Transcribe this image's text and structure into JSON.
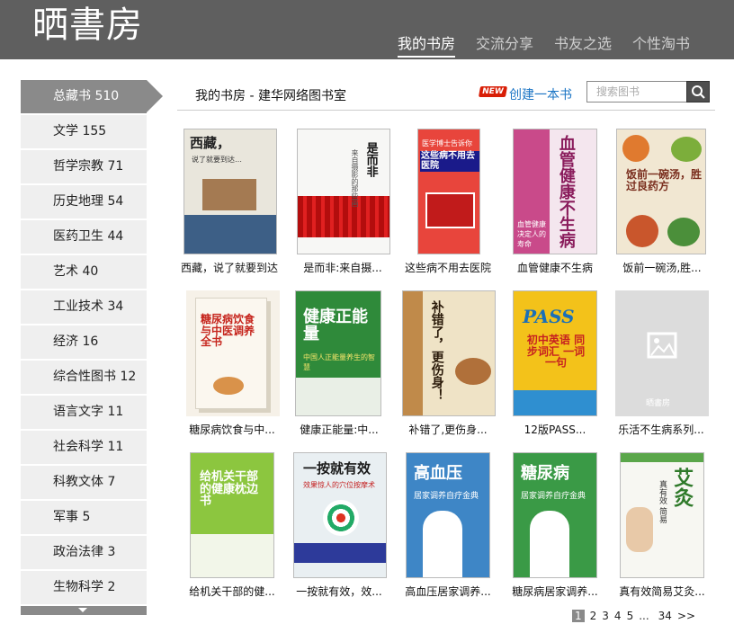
{
  "header": {
    "logo": "晒書房",
    "nav": [
      {
        "label": "我的书房",
        "active": true
      },
      {
        "label": "交流分享",
        "active": false
      },
      {
        "label": "书友之选",
        "active": false
      },
      {
        "label": "个性淘书",
        "active": false
      }
    ]
  },
  "sidebar": {
    "categories": [
      {
        "label": "总藏书 510",
        "active": true
      },
      {
        "label": "文学 155"
      },
      {
        "label": "哲学宗教 71"
      },
      {
        "label": "历史地理 54"
      },
      {
        "label": "医药卫生 44"
      },
      {
        "label": "艺术 40"
      },
      {
        "label": "工业技术 34"
      },
      {
        "label": "经济 16"
      },
      {
        "label": "综合性图书 12"
      },
      {
        "label": "语言文字 11"
      },
      {
        "label": "社会科学 11"
      },
      {
        "label": "科教文体 7"
      },
      {
        "label": "军事 5"
      },
      {
        "label": "政治法律 3"
      },
      {
        "label": "生物科学 2"
      }
    ]
  },
  "main": {
    "breadcrumb": "我的书房 - 建华网络图书室",
    "new_badge": "NEW",
    "create_link": "创建一本书",
    "search_placeholder": "搜索图书"
  },
  "books": [
    {
      "title": "西藏，说了就要到达",
      "cover_text": "西藏，",
      "cover_sub": "说了就要到达…",
      "cover_color": "#e9e6dc"
    },
    {
      "title": "是而非:来自摄...",
      "cover_text": "是而非",
      "cover_sub": "来自摄影的那些画",
      "cover_color": "#f7f7f5"
    },
    {
      "title": "这些病不用去医院",
      "cover_text": "这些病不用去医院",
      "cover_sub": "医学博士告诉你",
      "cover_color": "#e8453c"
    },
    {
      "title": "血管健康不生病",
      "cover_text": "血管健康不生病",
      "cover_sub": "血管健康决定人的寿命",
      "cover_color": "#c94a8a"
    },
    {
      "title": "饭前一碗汤,胜...",
      "cover_text": "饭前一碗汤，胜过良药方",
      "cover_sub": "",
      "cover_color": "#f1e7d2"
    },
    {
      "title": "糖尿病饮食与中...",
      "cover_text": "糖尿病饮食与中医调养全书",
      "cover_sub": "",
      "cover_color": "#f6f1e8"
    },
    {
      "title": "健康正能量:中...",
      "cover_text": "健康正能量",
      "cover_sub": "中国人正能量养生的智慧",
      "cover_color": "#2f8a3a"
    },
    {
      "title": "补错了,更伤身...",
      "cover_text": "补错了，更伤身！",
      "cover_sub": "",
      "cover_color": "#c08a4a"
    },
    {
      "title": "12版PASS...",
      "cover_text": "PASS",
      "cover_sub": "初中英语 同步词汇 一词一句",
      "cover_color": "#f3c21a"
    },
    {
      "title": "乐活不生病系列...",
      "cover_text": "晒書房",
      "cover_sub": "",
      "cover_color": "#dcdcdc"
    },
    {
      "title": "给机关干部的健...",
      "cover_text": "给机关干部的健康枕边书",
      "cover_sub": "",
      "cover_color": "#8cc63f"
    },
    {
      "title": "一按就有效，效...",
      "cover_text": "一按就有效",
      "cover_sub": "效果惊人的穴位按摩术",
      "cover_color": "#e9eff2"
    },
    {
      "title": "高血压居家调养...",
      "cover_text": "高血压",
      "cover_sub": "居家调养自疗金典",
      "cover_color": "#3e86c6"
    },
    {
      "title": "糖尿病居家调养...",
      "cover_text": "糖尿病",
      "cover_sub": "居家调养自疗金典",
      "cover_color": "#3a9a46"
    },
    {
      "title": "真有效简易艾灸...",
      "cover_text": "艾灸",
      "cover_sub": "真有效 简易",
      "cover_color": "#f7f7f2"
    }
  ],
  "pagination": {
    "pages": [
      "1",
      "2",
      "3",
      "4",
      "5",
      "...",
      "34",
      ">>"
    ],
    "current": "1"
  }
}
